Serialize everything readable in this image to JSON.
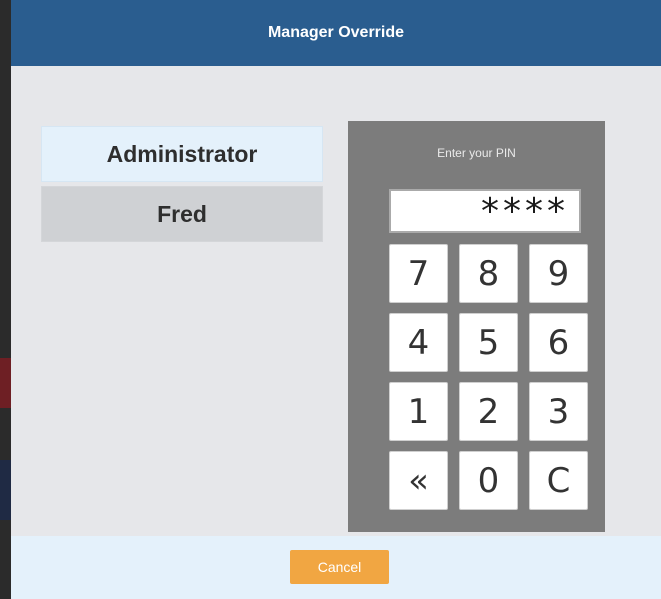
{
  "dialog": {
    "title": "Manager Override"
  },
  "users": [
    {
      "name": "Administrator",
      "selected": true
    },
    {
      "name": "Fred",
      "selected": false
    }
  ],
  "pinpad": {
    "prompt": "Enter your PIN",
    "masked_value": "****",
    "keys": [
      "7",
      "8",
      "9",
      "4",
      "5",
      "6",
      "1",
      "2",
      "3",
      "«",
      "0",
      "C"
    ]
  },
  "footer": {
    "cancel_label": "Cancel"
  },
  "colors": {
    "titlebar": "#2a5d8f",
    "selected_user": "#e4f1fb",
    "pinpad_bg": "#7c7c7c",
    "cancel": "#f1a642"
  }
}
